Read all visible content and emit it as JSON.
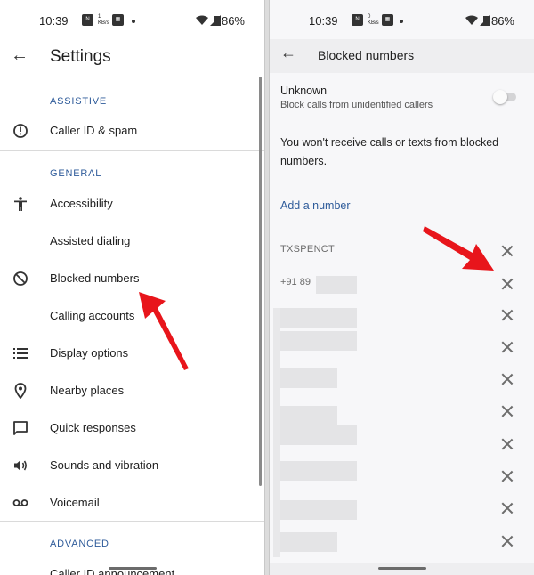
{
  "status_bar": {
    "time": "10:39",
    "battery": "86%"
  },
  "settings": {
    "title": "Settings",
    "sections": {
      "assistive": "ASSISTIVE",
      "general": "GENERAL",
      "advanced": "ADVANCED"
    },
    "items": {
      "caller_id": "Caller ID & spam",
      "accessibility": "Accessibility",
      "assisted_dialing": "Assisted dialing",
      "blocked_numbers": "Blocked numbers",
      "calling_accounts": "Calling accounts",
      "display_options": "Display options",
      "nearby_places": "Nearby places",
      "quick_responses": "Quick responses",
      "sounds_vibration": "Sounds and vibration",
      "voicemail": "Voicemail",
      "caller_id_announcement": "Caller ID announcement"
    }
  },
  "blocked": {
    "title": "Blocked numbers",
    "unknown_title": "Unknown",
    "unknown_subtitle": "Block calls from unidentified callers",
    "unknown_toggle": "off",
    "info": "You won't receive calls or texts from blocked numbers.",
    "add_number": "Add a number",
    "entries": [
      "TXSPENCT",
      "+91 89"
    ]
  },
  "colors": {
    "accent_blue": "#2e5b9a",
    "arrow_red": "#e8151b"
  }
}
